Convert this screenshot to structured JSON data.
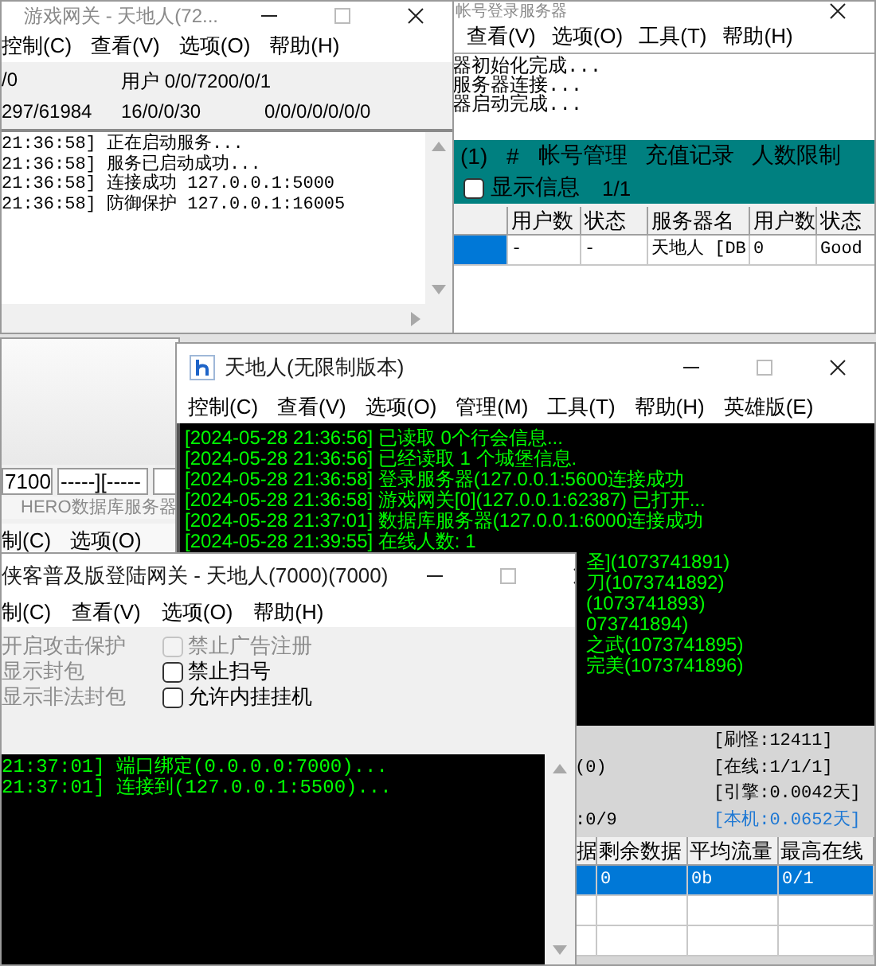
{
  "gateway_window": {
    "title": "游戏网关 - 天地人(72...",
    "active": false,
    "menu": [
      "控制(C)",
      "查看(V)",
      "选项(O)",
      "帮助(H)"
    ],
    "stats": [
      [
        "/0",
        "用户 0/0/7200/0/1"
      ],
      [
        "297/61984",
        "16/0/0/30",
        "0/0/0/0/0/0/0"
      ]
    ],
    "log": [
      "21:36:58] 正在启动服务...",
      "21:36:58] 服务已启动成功...",
      "21:36:58] 连接成功 127.0.0.1:5000",
      "21:36:58] 防御保护 127.0.0.1:16005"
    ]
  },
  "account_server_window": {
    "title": "帐号登录服务器",
    "active": false,
    "menu": [
      "查看(V)",
      "选项(O)",
      "工具(T)",
      "帮助(H)"
    ],
    "log": [
      "器初始化完成...",
      "服务器连接...",
      "器启动完成..."
    ],
    "toolbar": {
      "count": "(1)",
      "hash": "#",
      "links": [
        "帐号管理",
        "充值记录",
        "人数限制"
      ]
    },
    "show_info": {
      "label": "显示信息",
      "checked": false
    },
    "page": "1/1",
    "table": {
      "columns": [
        "用户数",
        "状态",
        "服务器名",
        "用户数",
        "状态"
      ],
      "rows": [
        {
          "selected": true,
          "cells": [
            "-",
            "-",
            "天地人 [DB",
            "0",
            "Good"
          ]
        }
      ]
    }
  },
  "back_window": {
    "fields": [
      "7100",
      "-----][-----"
    ],
    "title": "HERO数据库服务器",
    "menu": [
      "制(C)",
      "选项(O)"
    ]
  },
  "main_window": {
    "title": "天地人(无限制版本)",
    "active": true,
    "menu": [
      "控制(C)",
      "查看(V)",
      "选项(O)",
      "管理(M)",
      "工具(T)",
      "帮助(H)",
      "英雄版(E)"
    ],
    "log": [
      "[2024-05-28 21:36:56] 已读取 0个行会信息...",
      "[2024-05-28 21:36:56] 已经读取 1 个城堡信息.",
      "[2024-05-28 21:36:58] 登录服务器(127.0.0.1:5600连接成功",
      "[2024-05-28 21:36:58] 游戏网关[0](127.0.0.1:62387) 已打开...",
      "[2024-05-28 21:37:01] 数据库服务器(127.0.0.1:6000连接成功",
      "[2024-05-28 21:39:55] 在线人数: 1"
    ],
    "log_tails": [
      "圣](1073741891)",
      "刀(1073741892)",
      "(1073741893)",
      "073741894)",
      "之武(1073741895)",
      "完美(1073741896)"
    ],
    "stats_left": [
      "(0)",
      ":0/9"
    ],
    "stats_right": [
      {
        "text": "[刷怪:12411]",
        "color": "#000000"
      },
      {
        "text": "[在线:1/1/1]",
        "color": "#000000"
      },
      {
        "text": "[引擎:0.0042天]",
        "color": "#000000"
      },
      {
        "text": "[本机:0.0652天]",
        "color": "#1e78d4"
      }
    ],
    "table": {
      "columns": [
        "据",
        "剩余数据",
        "平均流量",
        "最高在线"
      ],
      "rows": [
        {
          "selected": true,
          "cells": [
            "",
            "0",
            "0b",
            "0/1"
          ]
        }
      ]
    }
  },
  "login_gateway_window": {
    "title": "侠客普及版登陆网关 - 天地人(7000)(7000)",
    "active": true,
    "menu": [
      "制(C)",
      "查看(V)",
      "选项(O)",
      "帮助(H)"
    ],
    "options_left": [
      {
        "label": "开启攻击保护",
        "disabled": true
      },
      {
        "label": "显示封包",
        "disabled": true
      },
      {
        "label": "显示非法封包",
        "disabled": true
      }
    ],
    "options_right": [
      {
        "label": "禁止广告注册",
        "checked": false,
        "disabled": true
      },
      {
        "label": "禁止扫号",
        "checked": false,
        "disabled": false
      },
      {
        "label": "允许内挂挂机",
        "checked": false,
        "disabled": false
      }
    ],
    "log": [
      "21:37:01] 端口绑定(0.0.0.0:7000)...",
      "21:37:01] 连接到(127.0.0.1:5500)..."
    ]
  }
}
